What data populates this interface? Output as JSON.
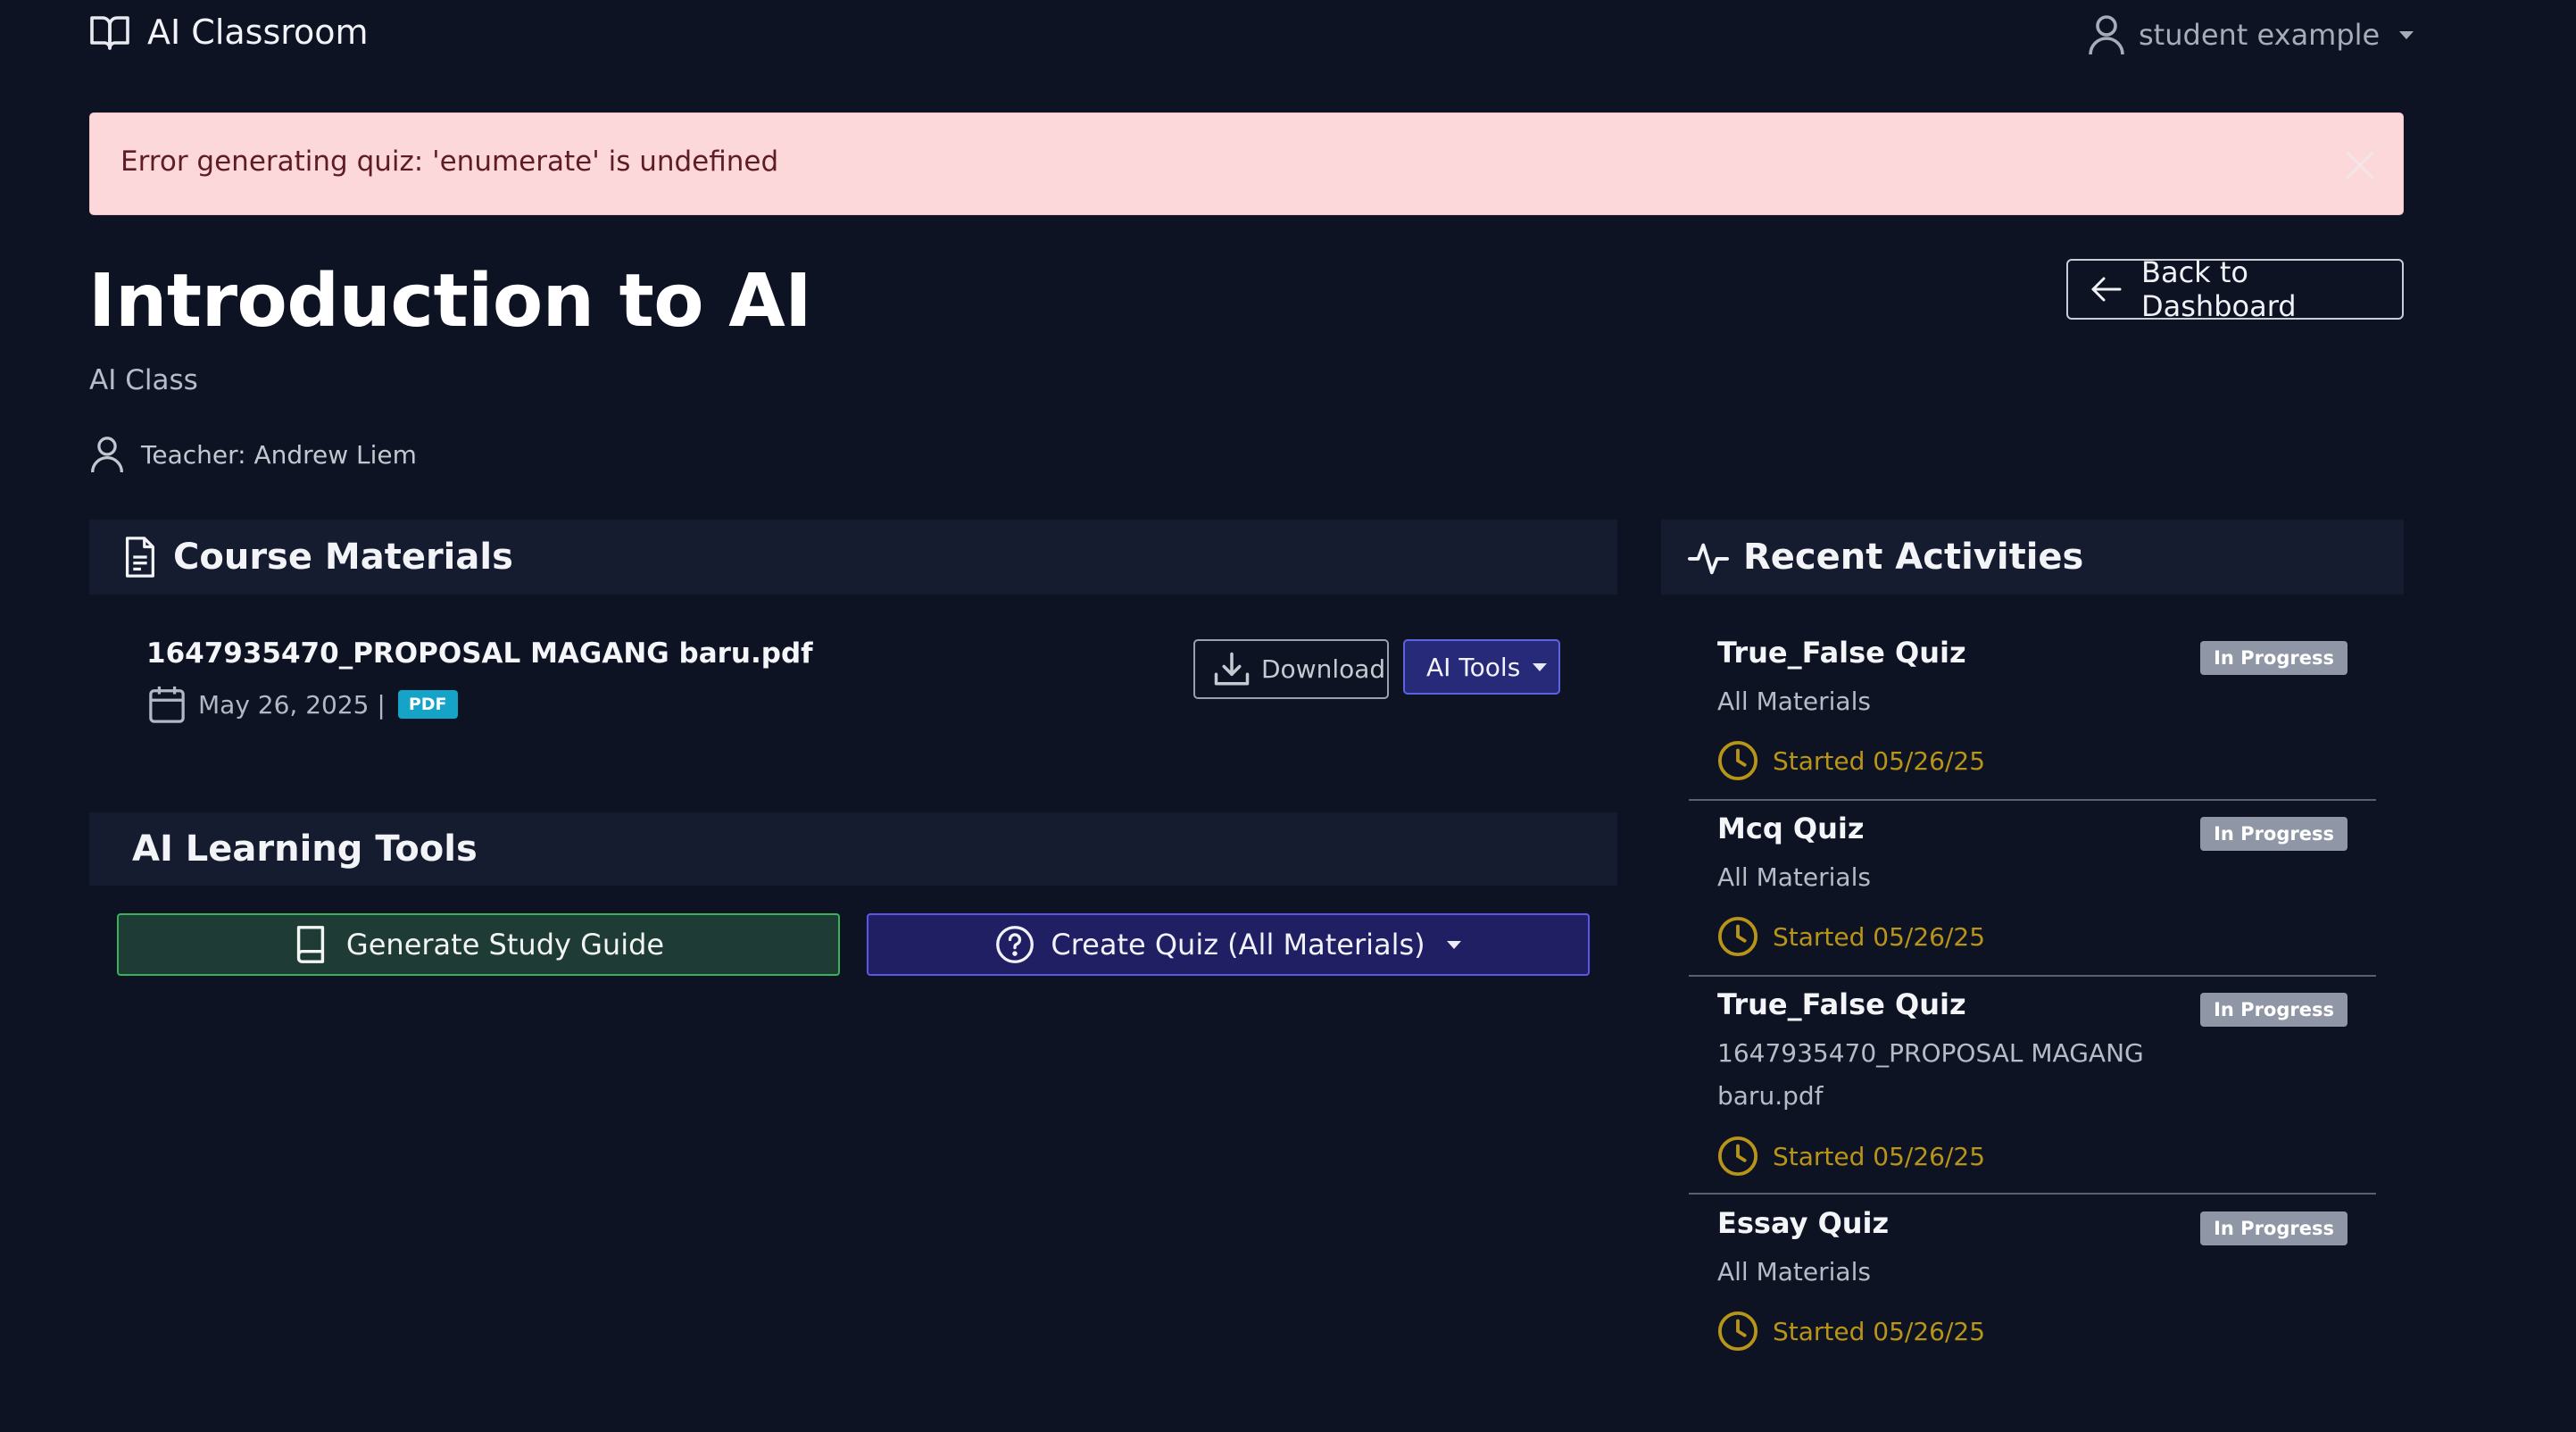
{
  "navbar": {
    "brand": "AI Classroom",
    "user": "student example"
  },
  "alert": {
    "message": "Error generating quiz: 'enumerate' is undefined"
  },
  "course": {
    "title": "Introduction to AI",
    "subtitle": "AI Class",
    "teacher": "Teacher: Andrew Liem",
    "back_label": "Back to Dashboard"
  },
  "materials": {
    "heading": "Course Materials",
    "items": [
      {
        "name": "1647935470_PROPOSAL MAGANG baru.pdf",
        "date": "May 26, 2025 |",
        "type": "PDF",
        "download_label": "Download",
        "ai_tools_label": "AI Tools"
      }
    ]
  },
  "ai_tools": {
    "heading": "AI Learning Tools",
    "study_guide_label": "Generate Study Guide",
    "quiz_label": "Create Quiz (All Materials)"
  },
  "activities": {
    "heading": "Recent Activities",
    "items": [
      {
        "title": "True_False Quiz",
        "subtitle": "All Materials",
        "status": "In Progress",
        "time": "Started 05/26/25"
      },
      {
        "title": "Mcq Quiz",
        "subtitle": "All Materials",
        "status": "In Progress",
        "time": "Started 05/26/25"
      },
      {
        "title": "True_False Quiz",
        "subtitle": "1647935470_PROPOSAL MAGANG baru.pdf",
        "status": "In Progress",
        "time": "Started 05/26/25"
      },
      {
        "title": "Essay Quiz",
        "subtitle": "All Materials",
        "status": "In Progress",
        "time": "Started 05/26/25"
      }
    ]
  },
  "colors": {
    "background": "#0e1324",
    "alert_bg": "#fdd8db",
    "success": "#39b35a",
    "primary": "#5e55e6",
    "warning": "#b89417",
    "info": "#15a3c7",
    "badge": "#8f96a5"
  },
  "icons": {
    "brand": "book-open-icon",
    "user": "user-icon",
    "close": "close-icon",
    "back": "arrow-left-icon",
    "materials": "file-text-icon",
    "activities": "activity-icon",
    "calendar": "calendar-icon",
    "download": "download-icon",
    "study": "book-icon",
    "quiz": "question-circle-icon",
    "clock": "clock-icon"
  }
}
